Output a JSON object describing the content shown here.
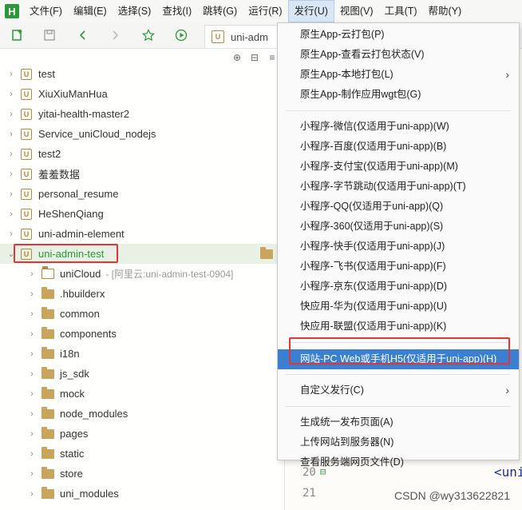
{
  "app": {
    "logo_letter": "H",
    "accent": "#2b9939",
    "highlight_color": "#e0363a"
  },
  "menubar": {
    "items": [
      "文件(F)",
      "编辑(E)",
      "选择(S)",
      "查找(I)",
      "跳转(G)",
      "运行(R)",
      "发行(U)",
      "视图(V)",
      "工具(T)",
      "帮助(Y)"
    ],
    "active_index": 6
  },
  "toolbar": {
    "tab_icon_letter": "U",
    "tab_label": "uni-adm",
    "icons": [
      "new-file-icon",
      "save-icon",
      "back-arrow-icon",
      "forward-arrow-icon",
      "star-icon",
      "run-icon"
    ]
  },
  "tree": {
    "tool_icons": [
      "target-icon",
      "collapse-icon",
      "menu-icon"
    ],
    "rows": [
      {
        "label": "test",
        "type": "project"
      },
      {
        "label": "XiuXiuManHua",
        "type": "project"
      },
      {
        "label": "yitai-health-master2",
        "type": "project"
      },
      {
        "label": "Service_uniCloud_nodejs",
        "type": "project"
      },
      {
        "label": "test2",
        "type": "project"
      },
      {
        "label": "羞羞数据",
        "type": "project"
      },
      {
        "label": "personal_resume",
        "type": "project"
      },
      {
        "label": "HeShenQiang",
        "type": "project"
      },
      {
        "label": "uni-admin-element",
        "type": "project"
      },
      {
        "label": "uni-admin-test",
        "type": "project-open"
      },
      {
        "label": "uniCloud",
        "suffix": "- [阿里云:uni-admin-test-0904]",
        "type": "folder-outline"
      },
      {
        "label": ".hbuilderx",
        "type": "folder"
      },
      {
        "label": "common",
        "type": "folder"
      },
      {
        "label": "components",
        "type": "folder"
      },
      {
        "label": "i18n",
        "type": "folder"
      },
      {
        "label": "js_sdk",
        "type": "folder"
      },
      {
        "label": "mock",
        "type": "folder"
      },
      {
        "label": "node_modules",
        "type": "folder"
      },
      {
        "label": "pages",
        "type": "folder"
      },
      {
        "label": "static",
        "type": "folder"
      },
      {
        "label": "store",
        "type": "folder"
      },
      {
        "label": "uni_modules",
        "type": "folder"
      }
    ]
  },
  "editor": {
    "line_numbers": [
      "20",
      "21"
    ],
    "code_snippet": "<uni",
    "watermark": "CSDN @wy313622821"
  },
  "dropdown": {
    "groups": [
      [
        "原生App-云打包(P)",
        "原生App-查看云打包状态(V)",
        "原生App-本地打包(L)",
        "原生App-制作应用wgt包(G)"
      ],
      [
        "小程序-微信(仅适用于uni-app)(W)",
        "小程序-百度(仅适用于uni-app)(B)",
        "小程序-支付宝(仅适用于uni-app)(M)",
        "小程序-字节跳动(仅适用于uni-app)(T)",
        "小程序-QQ(仅适用于uni-app)(Q)",
        "小程序-360(仅适用于uni-app)(S)",
        "小程序-快手(仅适用于uni-app)(J)",
        "小程序-飞书(仅适用于uni-app)(F)",
        "小程序-京东(仅适用于uni-app)(D)",
        "快应用-华为(仅适用于uni-app)(U)",
        "快应用-联盟(仅适用于uni-app)(K)"
      ],
      [
        "网站-PC Web或手机H5(仅适用于uni-app)(H)"
      ],
      [
        "自定义发行(C)"
      ],
      [
        "生成统一发布页面(A)",
        "上传网站到服务器(N)",
        "查看服务端网页文件(D)"
      ]
    ],
    "submenu_items": [
      "原生App-本地打包(L)",
      "自定义发行(C)"
    ],
    "hover_item": "网站-PC Web或手机H5(仅适用于uni-app)(H)",
    "hover_color": "#3a7fd0"
  }
}
